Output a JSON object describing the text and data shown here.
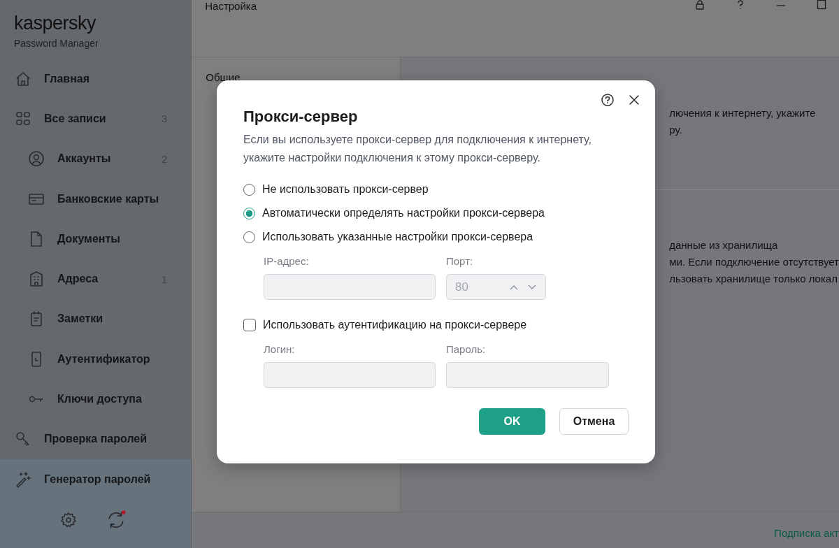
{
  "sidebar": {
    "logo": "kaspersky",
    "product": "Password Manager",
    "items": [
      {
        "label": "Главная"
      },
      {
        "label": "Все записи",
        "count": "3",
        "children": [
          {
            "label": "Аккаунты",
            "count": "2"
          },
          {
            "label": "Банковские карты"
          },
          {
            "label": "Документы"
          },
          {
            "label": "Адреса",
            "count": "1"
          },
          {
            "label": "Заметки"
          },
          {
            "label": "Аутентификатор"
          },
          {
            "label": "Ключи доступа"
          }
        ]
      },
      {
        "label": "Проверка паролей"
      }
    ],
    "bottom_items": [
      {
        "label": "Генератор паролей"
      }
    ],
    "sync_alert": true
  },
  "window": {
    "title": "Настройка"
  },
  "settings_nav": [
    {
      "label": "Общие"
    }
  ],
  "content": {
    "lines_top": [
      "лючения к интернету, укажите",
      "ру."
    ],
    "lines_bottom": [
      "данные из хранилища",
      "ми. Если подключение отсутствует",
      "льзовать хранилище только локал"
    ]
  },
  "status_bar": {
    "link": "Подписка акт"
  },
  "dialog": {
    "title": "Прокси-сервер",
    "description": "Если вы используете прокси-сервер для подключения к интернету, укажите настройки подключения к этому прокси-серверу.",
    "options": [
      {
        "label": "Не использовать прокси-сервер",
        "selected": false
      },
      {
        "label": "Автоматически определять настройки прокси-сервера",
        "selected": true
      },
      {
        "label": "Использовать указанные настройки прокси-сервера",
        "selected": false
      }
    ],
    "address_fields": [
      {
        "label": "IP-адрес:",
        "disabled": true,
        "kind": "text"
      },
      {
        "label": "Порт:",
        "value": "80",
        "disabled": true,
        "kind": "spinner"
      }
    ],
    "auth": {
      "label": "Использовать аутентификацию на прокси-сервере",
      "checked": false
    },
    "auth_fields": [
      {
        "label": "Логин:",
        "disabled": true,
        "kind": "text"
      },
      {
        "label": "Пароль:",
        "disabled": true,
        "kind": "password"
      }
    ],
    "buttons": [
      {
        "label": "OK",
        "kind": "primary"
      },
      {
        "label": "Отмена",
        "kind": "secondary"
      }
    ]
  }
}
